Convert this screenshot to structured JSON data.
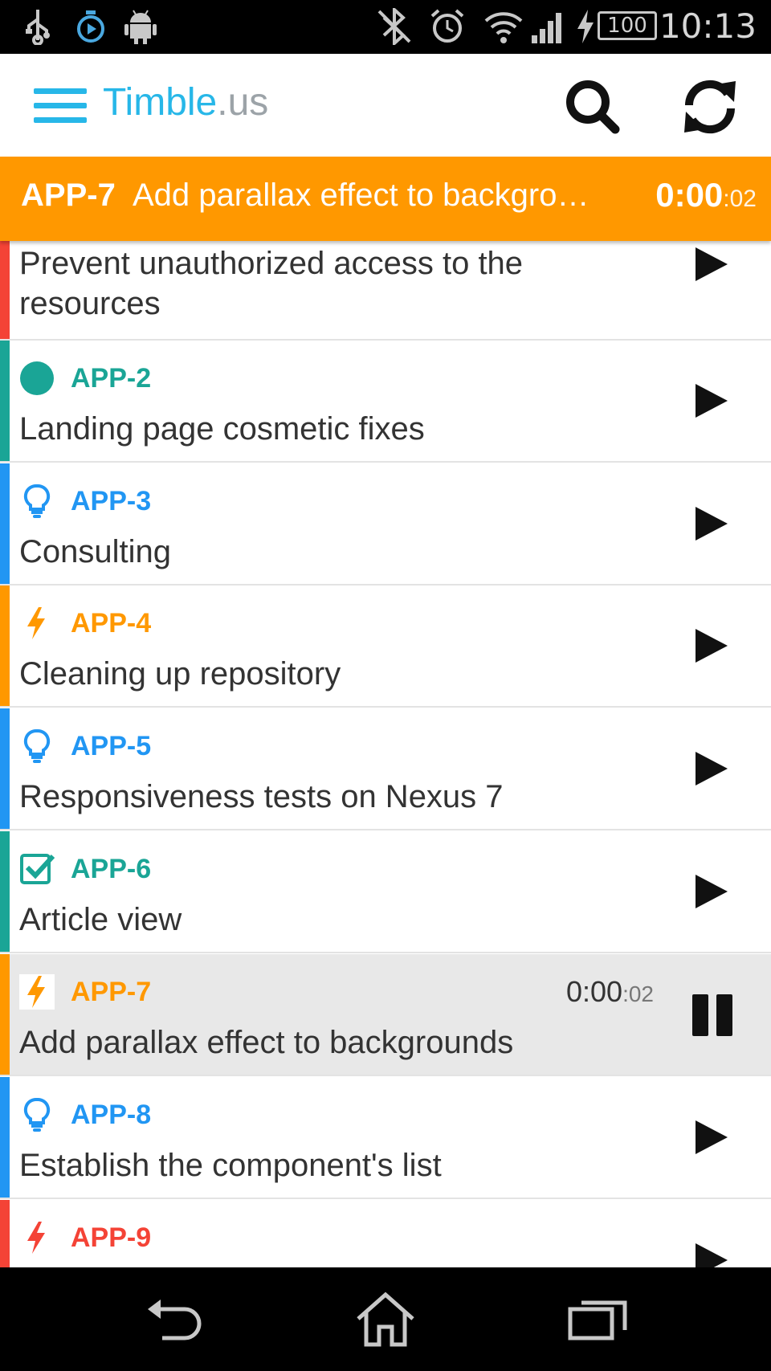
{
  "status_bar": {
    "battery": "100",
    "time": "10:13"
  },
  "app": {
    "brand_main": "Timble",
    "brand_ext": ".us"
  },
  "tracker": {
    "key": "APP-7",
    "title": "Add parallax effect to backgro…",
    "time_main": "0:00",
    "time_sec": ":02"
  },
  "tasks": [
    {
      "key": "",
      "title": "Prevent unauthorized access to the",
      "title2": "resources",
      "color": "#f44336",
      "icon": "none"
    },
    {
      "key": "APP-2",
      "title": "Landing page cosmetic fixes",
      "color": "#1aa596",
      "icon": "circle-icon"
    },
    {
      "key": "APP-3",
      "title": "Consulting",
      "color": "#2196f3",
      "icon": "lightbulb-icon"
    },
    {
      "key": "APP-4",
      "title": "Cleaning up repository",
      "color": "#ff9800",
      "icon": "lightning-icon"
    },
    {
      "key": "APP-5",
      "title": "Responsiveness tests on Nexus 7",
      "color": "#2196f3",
      "icon": "lightbulb-icon"
    },
    {
      "key": "APP-6",
      "title": "Article view",
      "color": "#1aa596",
      "icon": "checkbox-icon"
    },
    {
      "key": "APP-7",
      "title": "Add parallax effect to backgrounds",
      "color": "#ff9800",
      "icon": "lightning-icon",
      "time_main": "0:00",
      "time_sec": ":02",
      "active": true
    },
    {
      "key": "APP-8",
      "title": "Establish the component's list",
      "color": "#2196f3",
      "icon": "lightbulb-icon"
    },
    {
      "key": "APP-9",
      "title": "",
      "color": "#f44336",
      "icon": "lightning-icon"
    }
  ]
}
